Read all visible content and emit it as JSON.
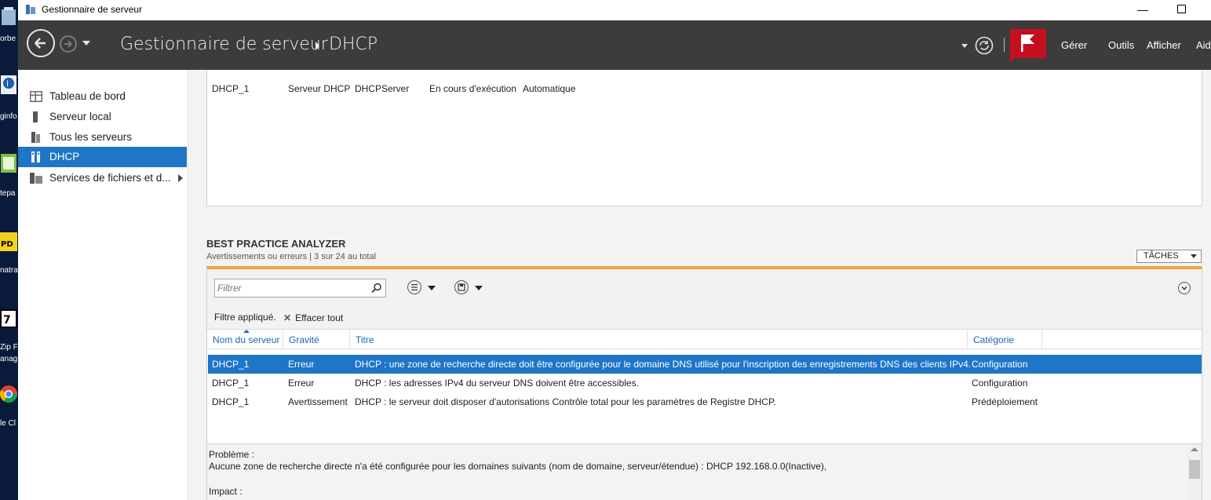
{
  "window": {
    "title": "Gestionnaire de serveur"
  },
  "desktop": {
    "labels": [
      "orbe",
      "ginfo",
      "tepa",
      "natra",
      "Zip F",
      "anag",
      "le Cl"
    ]
  },
  "header": {
    "breadcrumb_root": "Gestionnaire de serveur",
    "breadcrumb_current": "DHCP",
    "menu": [
      "Gérer",
      "Outils",
      "Afficher",
      "Aide"
    ]
  },
  "sidebar": {
    "items": [
      {
        "label": "Tableau de bord"
      },
      {
        "label": "Serveur local"
      },
      {
        "label": "Tous les serveurs"
      },
      {
        "label": "DHCP"
      },
      {
        "label": "Services de fichiers et d..."
      }
    ]
  },
  "services": {
    "row": [
      "DHCP_1",
      "Serveur DHCP",
      "DHCPServer",
      "En cours d'exécution",
      "Automatique"
    ]
  },
  "bpa": {
    "title": "BEST PRACTICE ANALYZER",
    "subtitle": "Avertissements ou erreurs | 3 sur 24 au total",
    "tasks_label": "TÂCHES",
    "filter_placeholder": "Filtrer",
    "filter_applied": "Filtre appliqué.",
    "clear_all": "Effacer tout",
    "columns": [
      "Nom du serveur",
      "Gravité",
      "Titre",
      "Catégorie"
    ],
    "rows": [
      [
        "DHCP_1",
        "Erreur",
        "DHCP : une zone de recherche directe doit être configurée pour le domaine DNS utilisé pour l'inscription des enregistrements DNS des clients IPv4.",
        "Configuration"
      ],
      [
        "DHCP_1",
        "Erreur",
        "DHCP : les adresses IPv4 du serveur DNS doivent être accessibles.",
        "Configuration"
      ],
      [
        "DHCP_1",
        "Avertissement",
        "DHCP : le serveur doit disposer d'autorisations Contrôle total pour les paramètres de Registre DHCP.",
        "Prédéploiement"
      ]
    ],
    "details": {
      "problem_label": "Problème :",
      "problem_text": "Aucune zone de recherche directe n'a été configurée pour les domaines suivants (nom de domaine, serveur/étendue) :  DHCP 192.168.0.0(Inactive),",
      "impact_label": "Impact :"
    }
  },
  "colors": {
    "header_bg": "#3c3c3c",
    "selection": "#1f75c6",
    "flag": "#c50f1f",
    "bpa_accent": "#f0a640",
    "column_header": "#1f63b3"
  }
}
